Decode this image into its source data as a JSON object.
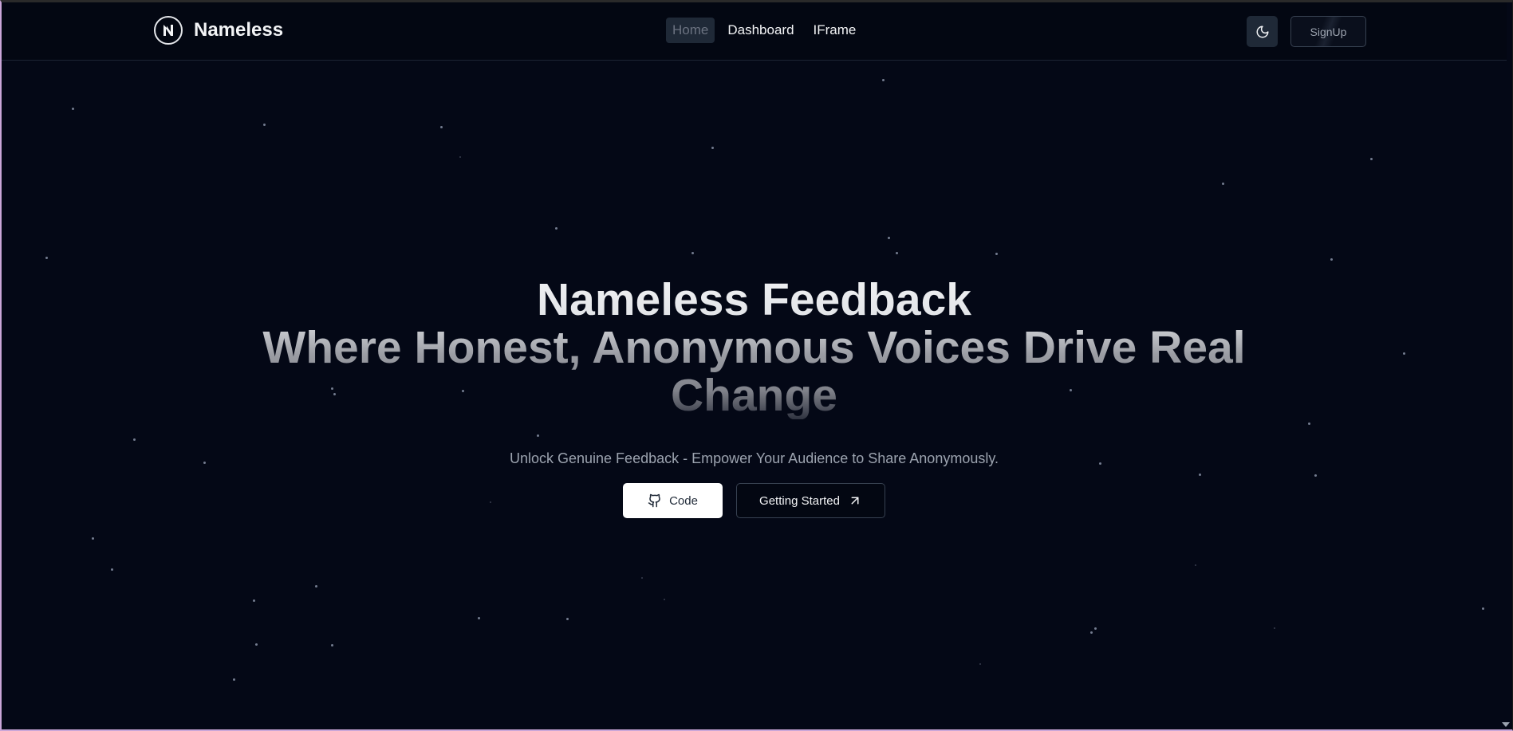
{
  "navbar": {
    "brand": "Nameless",
    "links": [
      {
        "label": "Home",
        "active": true
      },
      {
        "label": "Dashboard",
        "active": false
      },
      {
        "label": "IFrame",
        "active": false
      }
    ],
    "theme_icon": "moon-icon",
    "signup_label": "SignUp"
  },
  "hero": {
    "title_line1": "Nameless Feedback",
    "title_line2": "Where Honest, Anonymous Voices Drive Real",
    "title_line3": "Change",
    "subtitle": "Unlock Genuine Feedback - Empower Your Audience to Share Anonymously.",
    "code_button": "Code",
    "code_icon": "github-icon",
    "start_button": "Getting Started",
    "start_icon": "arrow-up-right-icon"
  },
  "colors": {
    "background": "#030712",
    "accent_white": "#ffffff",
    "muted_text": "#9ca3af"
  }
}
